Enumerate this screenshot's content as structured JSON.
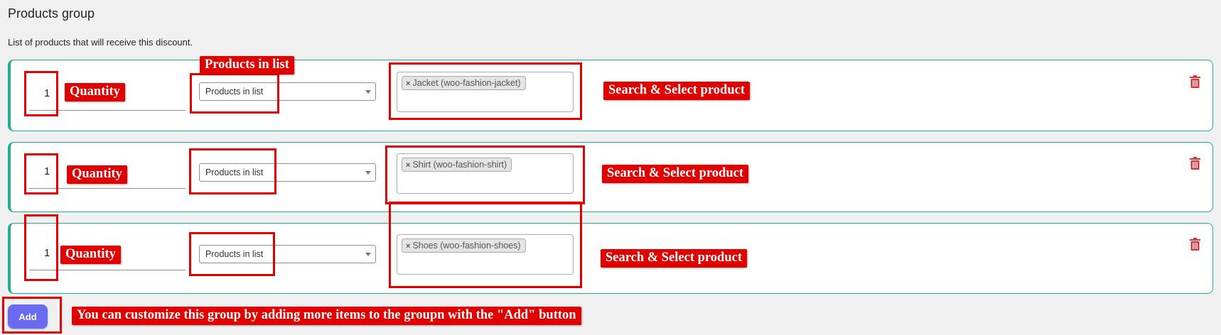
{
  "section": {
    "title": "Products group",
    "description": "List of products that will receive this discount."
  },
  "rows": [
    {
      "quantity": "1",
      "condition": "Products in list",
      "tag": "Jacket (woo-fashion-jacket)",
      "tag_remove": "×"
    },
    {
      "quantity": "1",
      "condition": "Products in list",
      "tag": "Shirt (woo-fashion-shirt)",
      "tag_remove": "×"
    },
    {
      "quantity": "1",
      "condition": "Products in list",
      "tag": "Shoes (woo-fashion-shoes)",
      "tag_remove": "×"
    }
  ],
  "add_button": {
    "label": "Add"
  },
  "annotations": {
    "quantity": "Quantity",
    "products_in_list": "Products in list",
    "search_select": "Search & Select product",
    "add_hint": "You can customize this group by adding more items to the groupn with the \"Add\" button"
  },
  "colors": {
    "row_border": "#1fae94",
    "annotation_red": "#e00000",
    "add_button": "#6a6af3",
    "trash_icon": "#d63638"
  },
  "icons": {
    "delete": "trash-icon",
    "dropdown": "chevron-down-icon"
  }
}
